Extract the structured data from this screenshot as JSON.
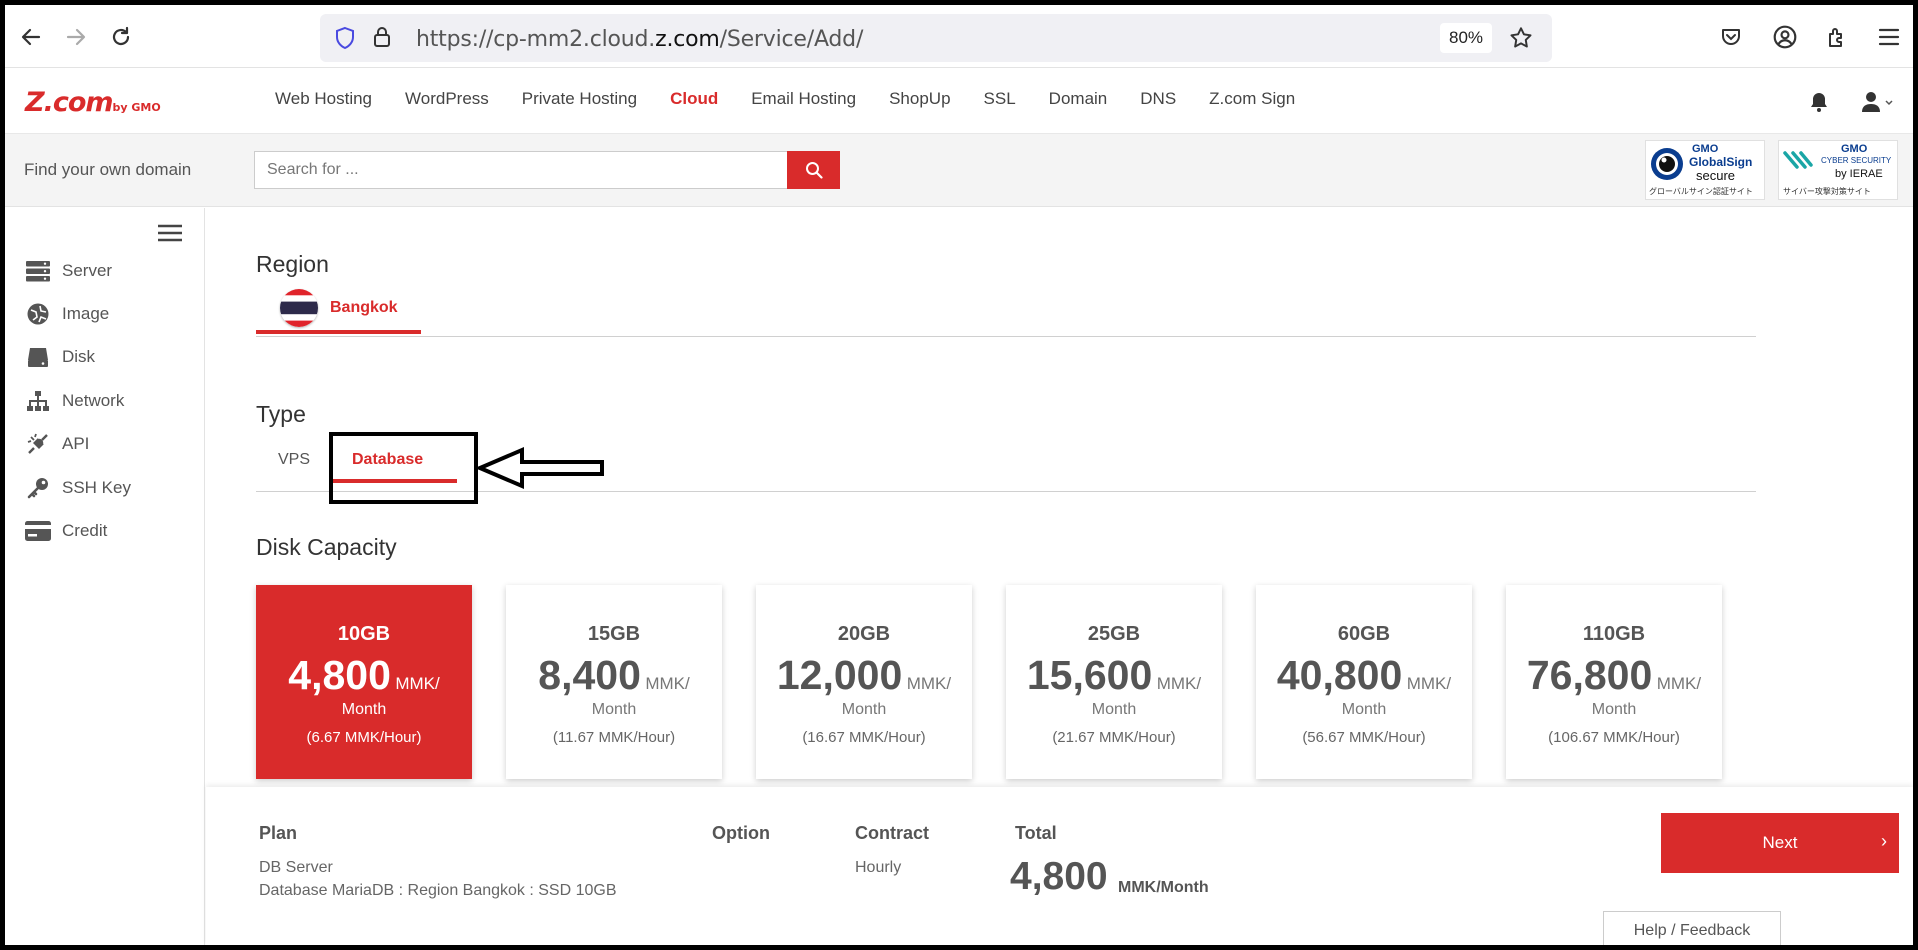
{
  "browser": {
    "url_prefix": "https://cp-mm2.cloud.",
    "url_domain": "z.com",
    "url_path": "/Service/Add/",
    "zoom": "80%"
  },
  "header": {
    "logo_text": "Z.com",
    "logo_sub": "by GMO",
    "nav": [
      "Web Hosting",
      "WordPress",
      "Private Hosting",
      "Cloud",
      "Email Hosting",
      "ShopUp",
      "SSL",
      "Domain",
      "DNS",
      "Z.com Sign"
    ],
    "active_nav": "Cloud"
  },
  "domain_search": {
    "label": "Find your own domain",
    "placeholder": "Search for ..."
  },
  "badges": {
    "globalsign_line1": "GMO",
    "globalsign_line2": "GlobalSign",
    "globalsign_line3": "secure",
    "globalsign_sub": "グローバルサイン認証サイト",
    "ierae_line1": "GMO",
    "ierae_line2": "CYBER SECURITY",
    "ierae_line3": "by IERAE",
    "ierae_sub": "サイバー攻撃対策サイト"
  },
  "sidebar": {
    "items": [
      {
        "label": "Server",
        "icon": "server-icon"
      },
      {
        "label": "Image",
        "icon": "image-icon"
      },
      {
        "label": "Disk",
        "icon": "disk-icon"
      },
      {
        "label": "Network",
        "icon": "network-icon"
      },
      {
        "label": "API",
        "icon": "api-icon"
      },
      {
        "label": "SSH Key",
        "icon": "key-icon"
      },
      {
        "label": "Credit",
        "icon": "credit-card-icon"
      }
    ]
  },
  "main": {
    "region_title": "Region",
    "region_name": "Bangkok",
    "type_title": "Type",
    "types": [
      "VPS",
      "Database"
    ],
    "selected_type": "Database",
    "disk_title": "Disk Capacity",
    "unit_label": "MMK/",
    "per_label": "Month",
    "cards": [
      {
        "capacity": "10GB",
        "price": "4,800",
        "hourly": "(6.67 MMK/Hour)",
        "selected": true
      },
      {
        "capacity": "15GB",
        "price": "8,400",
        "hourly": "(11.67 MMK/Hour)",
        "selected": false
      },
      {
        "capacity": "20GB",
        "price": "12,000",
        "hourly": "(16.67 MMK/Hour)",
        "selected": false
      },
      {
        "capacity": "25GB",
        "price": "15,600",
        "hourly": "(21.67 MMK/Hour)",
        "selected": false
      },
      {
        "capacity": "60GB",
        "price": "40,800",
        "hourly": "(56.67 MMK/Hour)",
        "selected": false
      },
      {
        "capacity": "110GB",
        "price": "76,800",
        "hourly": "(106.67 MMK/Hour)",
        "selected": false
      }
    ]
  },
  "summary": {
    "plan_head": "Plan",
    "plan_line1": "DB Server",
    "plan_line2": "Database MariaDB : Region Bangkok : SSD 10GB",
    "option_head": "Option",
    "contract_head": "Contract",
    "contract_value": "Hourly",
    "total_head": "Total",
    "total_amount": "4,800",
    "total_unit": "MMK/Month",
    "next_label": "Next",
    "next_chevron": "›",
    "help_label": "Help / Feedback"
  },
  "colors": {
    "accent": "#d92b2b"
  }
}
